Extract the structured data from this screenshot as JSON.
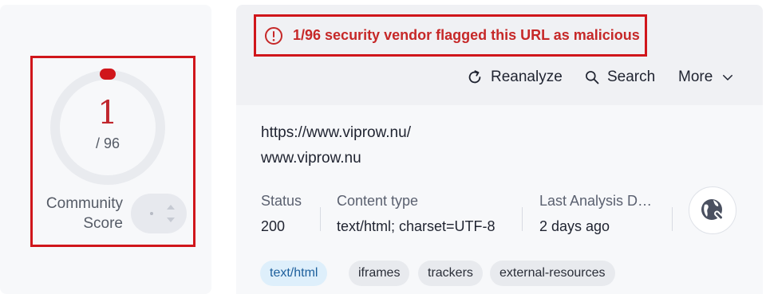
{
  "community_score": {
    "value": "1",
    "total": "/ 96",
    "label_line1": "Community",
    "label_line2": "Score"
  },
  "alert": {
    "icon": "alert-circle-icon",
    "text": "1/96 security vendor flagged this URL as malicious",
    "color": "#c62828"
  },
  "actions": {
    "reanalyze": "Reanalyze",
    "search": "Search",
    "more": "More"
  },
  "url_info": {
    "url": "https://www.viprow.nu/",
    "domain": "www.viprow.nu"
  },
  "meta": {
    "status_label": "Status",
    "status_value": "200",
    "content_type_label": "Content type",
    "content_type_value": "text/html; charset=UTF-8",
    "last_analysis_label": "Last Analysis D…",
    "last_analysis_value": "2 days ago"
  },
  "tags": [
    "text/html",
    "iframes",
    "trackers",
    "external-resources"
  ],
  "colors": {
    "malicious_red": "#d0161b",
    "score_red": "#c0262d",
    "tag_accent_bg": "#deeffb"
  }
}
